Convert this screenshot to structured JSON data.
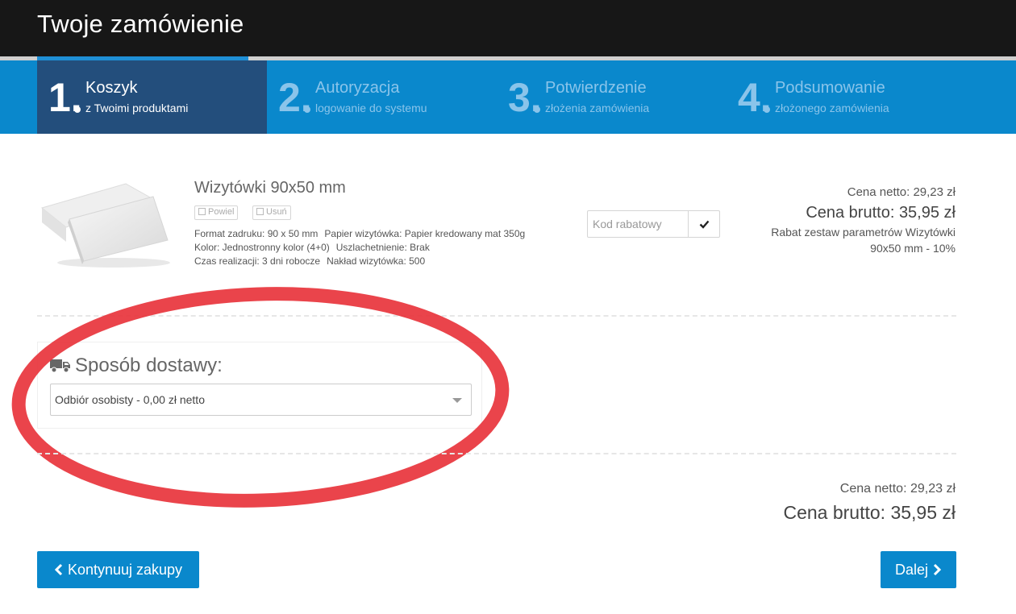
{
  "header": {
    "title": "Twoje zamówienie"
  },
  "steps": [
    {
      "num": "1.",
      "title": "Koszyk",
      "subtitle": "z Twoimi produktami",
      "active": true
    },
    {
      "num": "2.",
      "title": "Autoryzacja",
      "subtitle": "logowanie do systemu",
      "active": false
    },
    {
      "num": "3.",
      "title": "Potwierdzenie",
      "subtitle": "złożenia zamówienia",
      "active": false
    },
    {
      "num": "4.",
      "title": "Podsumowanie",
      "subtitle": "złożonego zamówienia",
      "active": false
    }
  ],
  "product": {
    "title": "Wizytówki 90x50 mm",
    "repeat_label": "Powiel",
    "remove_label": "Usuń",
    "specs": {
      "format": "Format zadruku: 90 x 50 mm",
      "paper": "Papier wizytówka: Papier kredowany mat 350g",
      "color": "Kolor: Jednostronny kolor (4+0)",
      "finish": "Uszlachetnienie: Brak",
      "time": "Czas realizacji: 3 dni robocze",
      "quantity": "Nakład wizytówka: 500"
    },
    "coupon_placeholder": "Kod rabatowy",
    "price_net": "Cena netto: 29,23 zł",
    "price_gross": "Cena brutto: 35,95 zł",
    "rebate_line1": "Rabat zestaw parametrów Wizytówki",
    "rebate_line2": "90x50 mm - 10%"
  },
  "delivery": {
    "title": "Sposób dostawy:",
    "selected": "Odbiór osobisty - 0,00 zł netto"
  },
  "totals": {
    "net": "Cena netto: 29,23 zł",
    "gross": "Cena brutto: 35,95 zł"
  },
  "buttons": {
    "continue": "Kontynuuj zakupy",
    "next": "Dalej"
  },
  "colors": {
    "steps_bar": "#0a88cc",
    "active_step": "#234e7c",
    "header": "#171717",
    "button": "#0a88cc",
    "highlight": "#e8343c"
  },
  "icons": [
    "copy-icon",
    "trash-icon",
    "check-icon",
    "truck-icon",
    "chevron-left-icon",
    "chevron-right-icon",
    "caret-down-icon"
  ]
}
